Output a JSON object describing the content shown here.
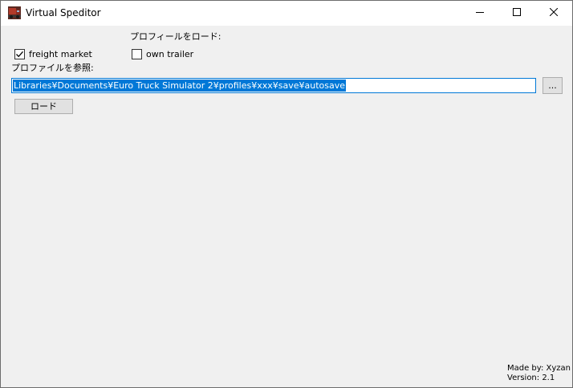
{
  "window": {
    "title": "Virtual Speditor",
    "app_icon": "truck-app-icon",
    "controls": {
      "minimize": "minimize-icon",
      "maximize": "maximize-icon",
      "close": "close-icon"
    }
  },
  "options": {
    "load_profile_label": "プロフィールをロード:",
    "freight_market": {
      "label": "freight market",
      "checked": true
    },
    "own_trailer": {
      "label": "own trailer",
      "checked": false
    }
  },
  "profile": {
    "browse_label": "プロファイルを参照:",
    "path_value": "Libraries¥Documents¥Euro Truck Simulator 2¥profiles¥xxx¥save¥autosave",
    "browse_button_label": "...",
    "load_button_label": "ロード"
  },
  "footer": {
    "made_by": "Made by: Xyzan",
    "version": "Version: 2.1"
  },
  "colors": {
    "accent": "#0078d7",
    "background": "#f0f0f0",
    "titlebar": "#ffffff"
  }
}
